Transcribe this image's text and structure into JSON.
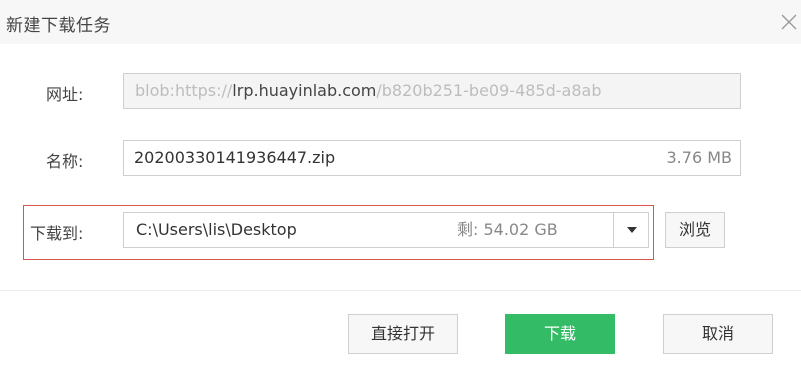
{
  "dialog": {
    "title": "新建下载任务"
  },
  "url_row": {
    "label": "网址:",
    "prefix": "blob:https://",
    "host": "lrp.huayinlab.com",
    "suffix": "/b820b251-be09-485d-a8ab"
  },
  "name_row": {
    "label": "名称:",
    "filename": "20200330141936447.zip",
    "size": "3.76 MB"
  },
  "path_row": {
    "label": "下载到:",
    "path": "C:\\Users\\lis\\Desktop",
    "free_space": "剩: 54.02 GB",
    "browse_label": "浏览"
  },
  "buttons": {
    "open_label": "直接打开",
    "download_label": "下载",
    "cancel_label": "取消"
  },
  "colors": {
    "primary": "#33bb66",
    "highlight_border": "#d9534f"
  },
  "icons": {
    "close": "close-icon",
    "dropdown": "chevron-down-icon"
  }
}
